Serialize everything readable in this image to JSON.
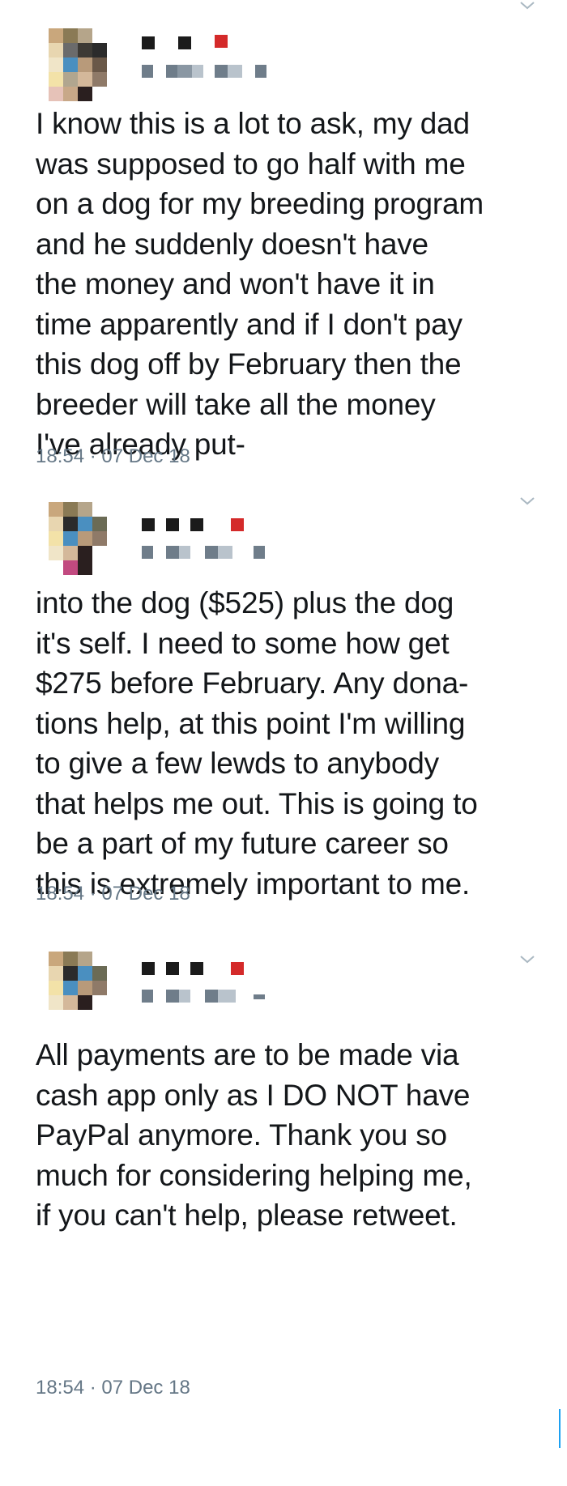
{
  "tweets": [
    {
      "text": "I know this is a lot to ask, my dad\nwas supposed to go half with me\non a dog for my breeding program\nand he suddenly doesn't have\nthe money and won't have it in\ntime apparently and if I don't pay\nthis dog off by February then the\nbreeder will take all the money\nI've already put-",
      "timestamp": "18:54 · 07 Dec 18"
    },
    {
      "text": "into the dog ($525) plus the dog\nit's self. I need to some how get\n$275 before February. Any dona-\ntions help, at this point I'm willing\nto give a few lewds to anybody\nthat helps me out. This is going to\nbe a part of my future career so\nthis is extremely important to me.",
      "timestamp": "18:54 · 07 Dec 18"
    },
    {
      "text": "All payments are to be made via\ncash app only as I DO NOT have\nPayPal anymore. Thank you so\nmuch for considering helping me,\nif you can't help, please retweet.",
      "timestamp": "18:54 · 07 Dec 18"
    }
  ],
  "icons": {
    "more_menu": "chevron-down-icon"
  },
  "colors": {
    "text": "#14171a",
    "meta": "#657786",
    "chevron": "#aab8c2",
    "accent": "#1da1f2"
  }
}
